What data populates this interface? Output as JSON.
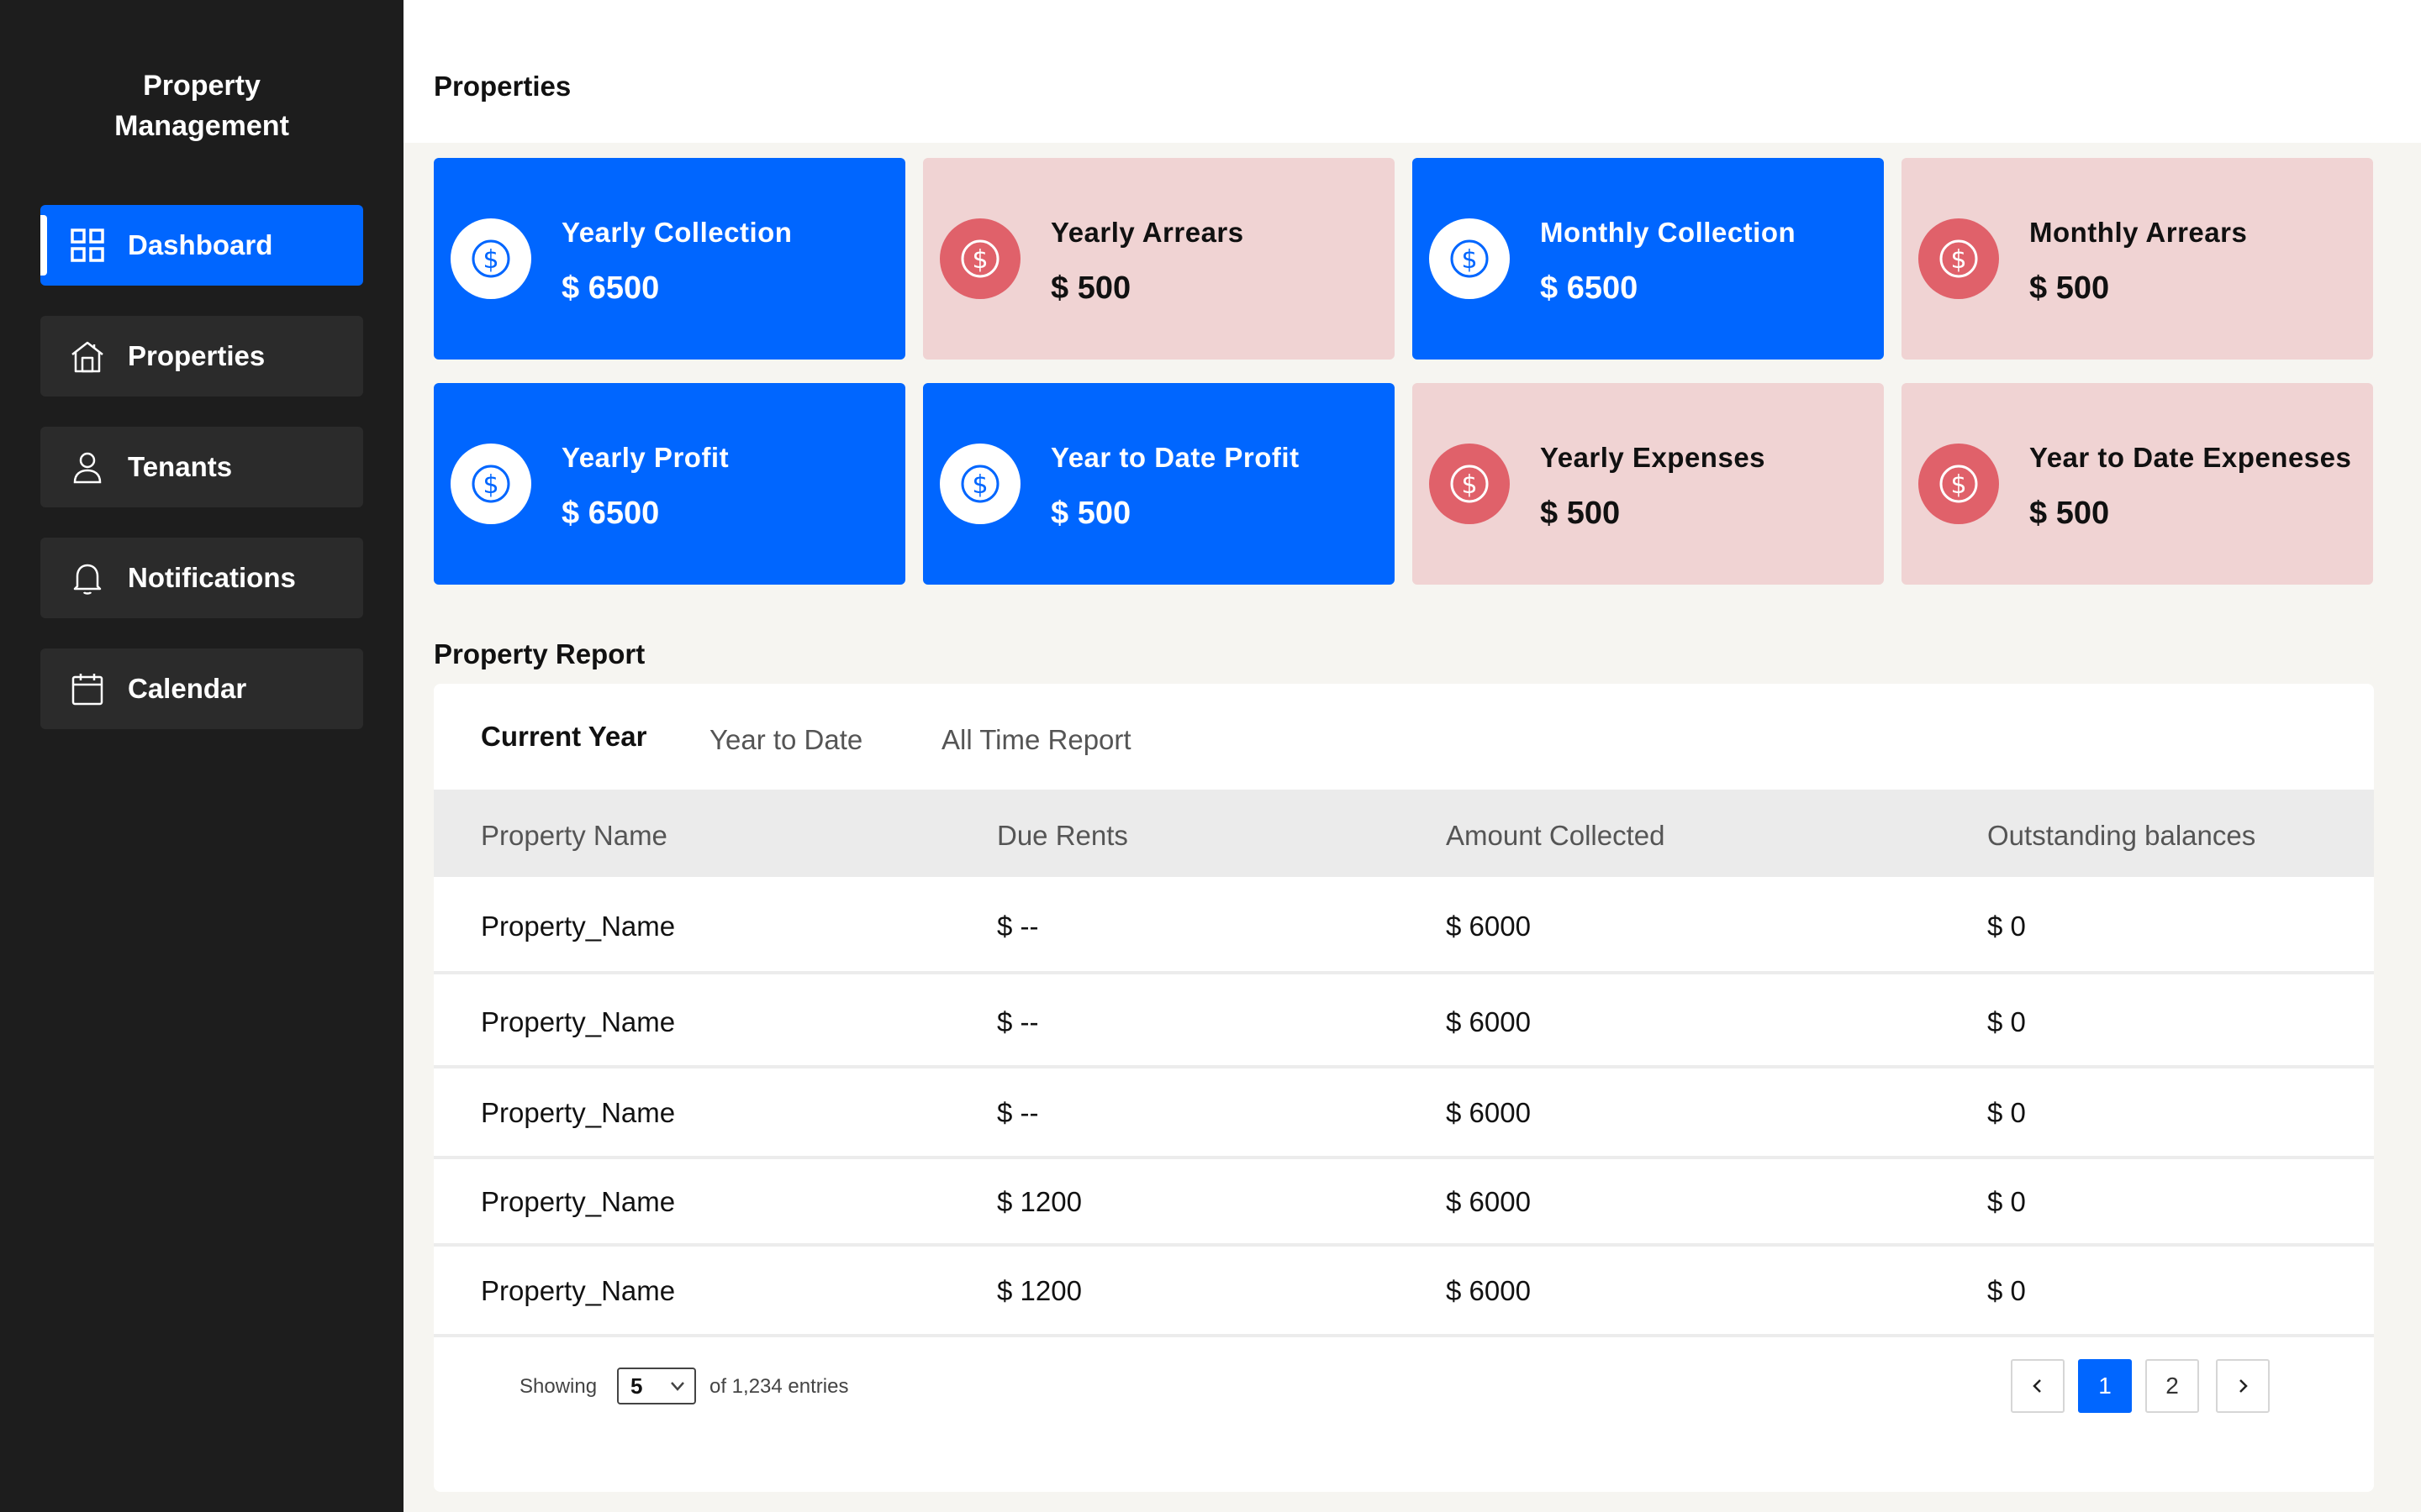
{
  "sidebar": {
    "brand_line1": "Property",
    "brand_line2": "Management",
    "items": [
      {
        "label": "Dashboard",
        "icon": "grid-icon",
        "active": true
      },
      {
        "label": "Properties",
        "icon": "house-icon",
        "active": false
      },
      {
        "label": "Tenants",
        "icon": "user-icon",
        "active": false
      },
      {
        "label": "Notifications",
        "icon": "bell-icon",
        "active": false
      },
      {
        "label": "Calendar",
        "icon": "calendar-icon",
        "active": false
      }
    ]
  },
  "header": {
    "title": "Properties"
  },
  "cards": [
    {
      "label": "Yearly Collection",
      "value": "$ 6500",
      "variant": "blue"
    },
    {
      "label": "Yearly Arrears",
      "value": "$ 500",
      "variant": "pink"
    },
    {
      "label": "Monthly Collection",
      "value": "$ 6500",
      "variant": "blue"
    },
    {
      "label": "Monthly Arrears",
      "value": "$ 500",
      "variant": "pink"
    },
    {
      "label": "Yearly Profit",
      "value": "$ 6500",
      "variant": "blue"
    },
    {
      "label": "Year to Date Profit",
      "value": "$ 500",
      "variant": "blue"
    },
    {
      "label": "Yearly Expenses",
      "value": "$ 500",
      "variant": "pink"
    },
    {
      "label": "Year to Date Expeneses",
      "value": "$ 500",
      "variant": "pink"
    }
  ],
  "report": {
    "title": "Property Report",
    "tabs": [
      {
        "label": "Current Year",
        "active": true
      },
      {
        "label": "Year to Date",
        "active": false
      },
      {
        "label": "All Time Report",
        "active": false
      }
    ],
    "columns": [
      "Property Name",
      "Due Rents",
      "Amount Collected",
      "Outstanding balances"
    ],
    "rows": [
      [
        "Property_Name",
        "$ --",
        "$ 6000",
        "$ 0"
      ],
      [
        "Property_Name",
        "$ --",
        "$ 6000",
        "$ 0"
      ],
      [
        "Property_Name",
        "$ --",
        "$ 6000",
        "$ 0"
      ],
      [
        "Property_Name",
        "$ 1200",
        "$ 6000",
        "$ 0"
      ],
      [
        "Property_Name",
        "$ 1200",
        "$ 6000",
        "$ 0"
      ]
    ],
    "footer": {
      "showing_label": "Showing",
      "page_size": "5",
      "entries_label": "of 1,234 entries",
      "pages": [
        "1",
        "2"
      ],
      "current_page": "1"
    }
  },
  "colors": {
    "accent_blue": "#0066ff",
    "card_pink": "#f0d3d3",
    "coin_red": "#e0616a",
    "sidebar_bg": "#1d1d1d"
  }
}
